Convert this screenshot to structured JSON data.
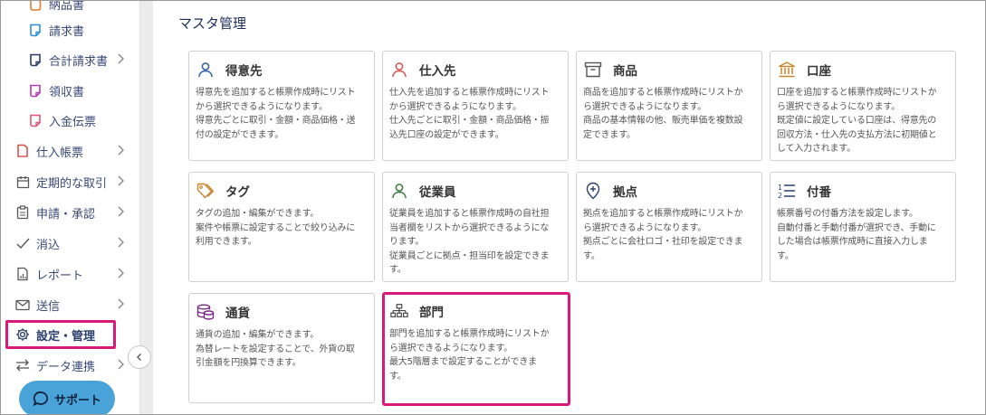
{
  "sidebar": {
    "items": [
      {
        "label": "納品書",
        "type": "sub"
      },
      {
        "label": "請求書",
        "type": "sub"
      },
      {
        "label": "合計請求書",
        "type": "sub"
      },
      {
        "label": "領収書",
        "type": "sub"
      },
      {
        "label": "入金伝票",
        "type": "sub"
      },
      {
        "label": "仕入帳票",
        "type": "top"
      },
      {
        "label": "定期的な取引",
        "type": "top"
      },
      {
        "label": "申請・承認",
        "type": "top"
      },
      {
        "label": "消込",
        "type": "top"
      },
      {
        "label": "レポート",
        "type": "top"
      },
      {
        "label": "送信",
        "type": "top"
      },
      {
        "label": "設定・管理",
        "type": "top"
      },
      {
        "label": "データ連携",
        "type": "top"
      }
    ],
    "support_label": "サポート"
  },
  "main": {
    "title": "マスタ管理",
    "cards": [
      {
        "title": "得意先",
        "icon": "person-icon",
        "desc": "得意先を追加すると帳票作成時にリスト\nから選択できるようになります。\n得意先ごとに取引・金額・商品価格・送\n付の設定ができます。"
      },
      {
        "title": "仕入先",
        "icon": "person-icon",
        "desc": "仕入先を追加すると帳票作成時にリスト\nから選択できるようになります。\n仕入先ごとに取引・金額・商品価格・振\n込先口座の設定ができます。"
      },
      {
        "title": "商品",
        "icon": "box-icon",
        "desc": "商品を追加すると帳票作成時にリストか\nら選択できるようになります。\n商品の基本情報の他、販売単価を複数設\n定できます。"
      },
      {
        "title": "口座",
        "icon": "bank-icon",
        "desc": "口座を追加すると帳票作成時にリストか\nら選択できるようになります。\n既定値に設定している口座は、得意先の\n回収方法・仕入先の支払方法に初期値と\nして入力されます。"
      },
      {
        "title": "タグ",
        "icon": "tag-icon",
        "desc": "タグの追加・編集ができます。\n案件や帳票に設定することで絞り込みに\n利用できます。"
      },
      {
        "title": "従業員",
        "icon": "person-icon",
        "desc": "従業員を追加すると帳票作成時の自社担\n当者欄をリストから選択できるようにな\nります。\n従業員ごとに拠点・担当印を設定できま\nす。"
      },
      {
        "title": "拠点",
        "icon": "location-icon",
        "desc": "拠点を追加すると帳票作成時にリストか\nら選択できるようになります。\n拠点ごとに会社ロゴ・社印を設定できま\nす。"
      },
      {
        "title": "付番",
        "icon": "numbered-list-icon",
        "desc": "帳票番号の付番方法を設定します。\n自動付番と手動付番が選択でき、手動に\nした場合は帳票作成時に直接入力しま\nす。"
      },
      {
        "title": "通貨",
        "icon": "coins-icon",
        "desc": "通貨の追加・編集ができます。\n為替レートを設定することで、外貨の取\n引金額を円換算できます。"
      },
      {
        "title": "部門",
        "icon": "org-chart-icon",
        "desc": "部門を追加すると帳票作成時にリストか\nら選択できるようになります。\n最大5階層まで設定することができま\nす。"
      }
    ]
  },
  "colors": {
    "accent_highlight": "#d81b7a",
    "nav_text": "#3a4a78",
    "support_bg": "#4aa3d8",
    "icon_blue": "#2c5fa8",
    "icon_red": "#d9534f",
    "icon_orange": "#c8842a",
    "icon_purple": "#7b2a86",
    "icon_green": "#3b7a3b"
  }
}
